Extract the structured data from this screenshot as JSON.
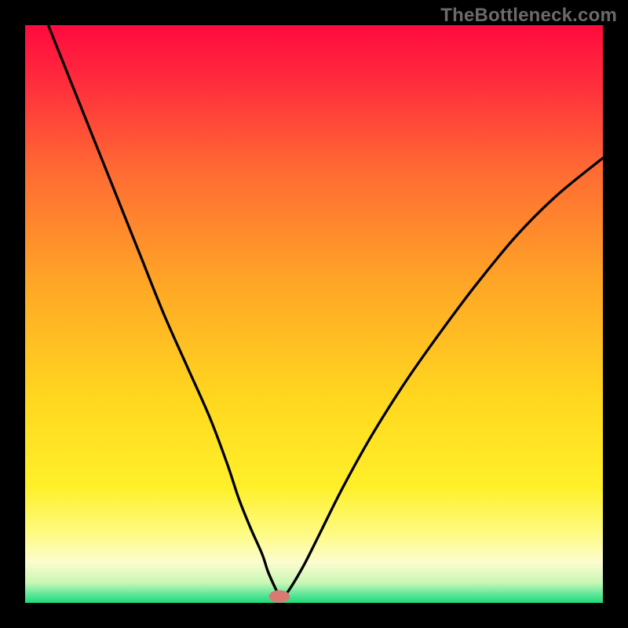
{
  "watermark": "TheBottleneck.com",
  "colors": {
    "frame": "#000000",
    "curve": "#000000",
    "marker_fill": "#d77a72",
    "gradient_stops": [
      {
        "offset": 0.0,
        "color": "#ff0a3e"
      },
      {
        "offset": 0.1,
        "color": "#ff2d3d"
      },
      {
        "offset": 0.25,
        "color": "#ff6a33"
      },
      {
        "offset": 0.45,
        "color": "#ffa726"
      },
      {
        "offset": 0.65,
        "color": "#ffd81f"
      },
      {
        "offset": 0.8,
        "color": "#fff02a"
      },
      {
        "offset": 0.88,
        "color": "#fefb83"
      },
      {
        "offset": 0.93,
        "color": "#fcfccf"
      },
      {
        "offset": 0.965,
        "color": "#caf7b5"
      },
      {
        "offset": 0.985,
        "color": "#5fe89a"
      },
      {
        "offset": 1.0,
        "color": "#1fd978"
      }
    ]
  },
  "chart_data": {
    "type": "line",
    "title": "",
    "xlabel": "",
    "ylabel": "",
    "xlim": [
      0,
      100
    ],
    "ylim": [
      0,
      100
    ],
    "x": [
      4,
      8,
      12,
      16,
      20,
      24,
      28,
      32,
      35,
      37,
      39,
      41,
      42,
      43,
      43.7,
      44.3,
      45.2,
      46.5,
      48.5,
      51,
      55,
      60,
      66,
      72,
      78,
      85,
      92,
      100
    ],
    "values": [
      100,
      90,
      80,
      70,
      60,
      50,
      41,
      32,
      24,
      18,
      13,
      8.5,
      5.5,
      3.2,
      1.8,
      1.2,
      1.6,
      3.5,
      7,
      12,
      20,
      29,
      38.5,
      47,
      55,
      63.5,
      70.5,
      77
    ],
    "marker": {
      "x": 44,
      "y": 1.1,
      "rx": 1.8,
      "ry": 1.1,
      "angle": 0
    }
  }
}
